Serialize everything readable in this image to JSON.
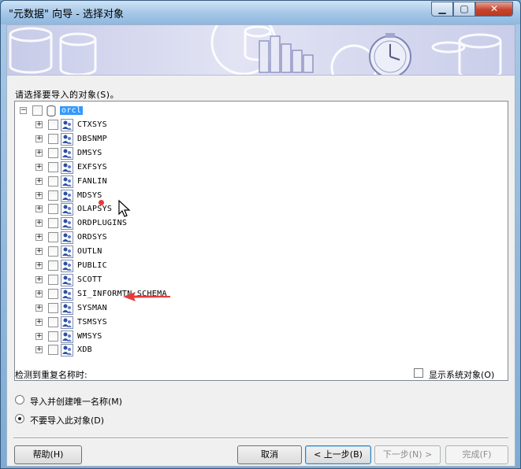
{
  "window": {
    "title": "\"元数据\" 向导 - 选择对象",
    "min_icon": "minimize-icon",
    "max_icon": "maximize-icon",
    "close_icon": "close-icon"
  },
  "prompt": "请选择要导入的对象(S)。",
  "tree": {
    "root": "orcl",
    "items": [
      "CTXSYS",
      "DBSNMP",
      "DMSYS",
      "EXFSYS",
      "FANLIN",
      "MDSYS",
      "OLAPSYS",
      "ORDPLUGINS",
      "ORDSYS",
      "OUTLN",
      "PUBLIC",
      "SCOTT",
      "SI_INFORMTN_SCHEMA",
      "SYSMAN",
      "TSMSYS",
      "WMSYS",
      "XDB"
    ]
  },
  "duplicate": {
    "label": "检测到重复名称时:",
    "options": [
      "导入并创建唯一名称(M)",
      "不要导入此对象(D)"
    ],
    "selected_index": 1
  },
  "show_system": {
    "label": "显示系统对象(O)",
    "checked": false
  },
  "buttons": {
    "help": "帮助(H)",
    "cancel": "取消",
    "back": "< 上一步(B)",
    "next": "下一步(N) >",
    "finish": "完成(F)"
  },
  "colors": {
    "selection": "#3399ff",
    "annotation": "#e43b3b"
  }
}
